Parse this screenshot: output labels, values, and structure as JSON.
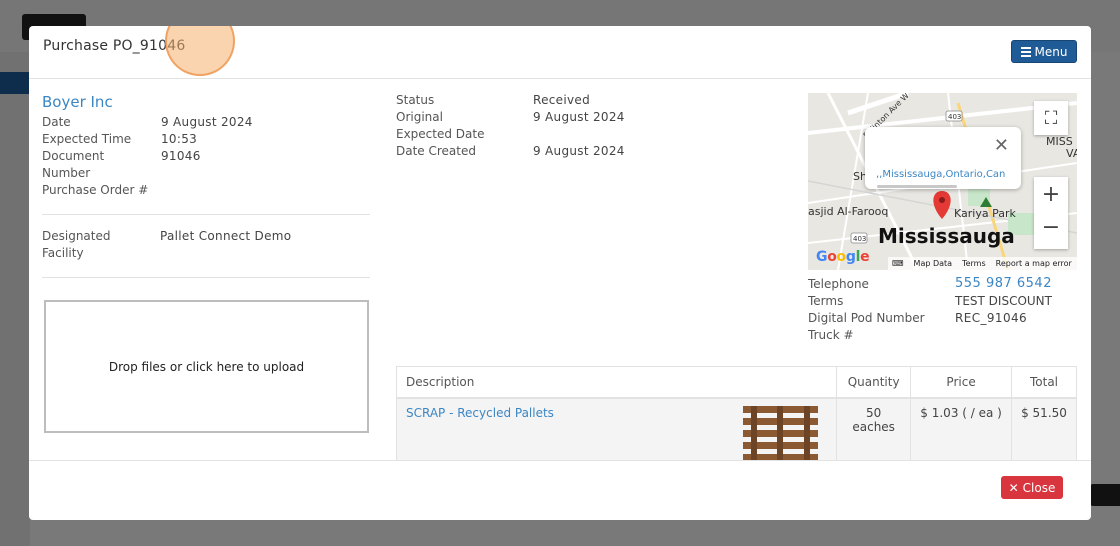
{
  "modal": {
    "title": "Purchase PO_91046",
    "menu_label": "Menu",
    "close_label": "Close"
  },
  "vendor": "Boyer Inc",
  "details_left": [
    {
      "label": "Date",
      "value": "9 August 2024"
    },
    {
      "label": "Expected Time",
      "value": "10:53"
    },
    {
      "label": "Document Number",
      "value": "91046"
    },
    {
      "label": "Purchase Order #",
      "value": ""
    }
  ],
  "facility": {
    "label": "Designated Facility",
    "value": "Pallet Connect Demo"
  },
  "dropzone_text": "Drop files or click here to upload",
  "details_mid": [
    {
      "label": "Status",
      "value": "Received"
    },
    {
      "label": "Original Expected Date",
      "value": "9 August 2024"
    },
    {
      "label": "Date Created",
      "value": "9 August 2024"
    }
  ],
  "map": {
    "popup_link": ",,Mississauga,Ontario,Can",
    "city": "Mississauga",
    "labels": [
      "Kariya Park",
      "asjid Al-Farooq",
      "Sh",
      "MISS",
      "VA",
      "Eglinton Ave W"
    ],
    "road_numbers": [
      "403",
      "403"
    ],
    "google": "Google",
    "footer": [
      "Map Data",
      "Terms",
      "Report a map error"
    ]
  },
  "details_right": [
    {
      "label": "Telephone",
      "value": "555 987 6542"
    },
    {
      "label": "Terms",
      "value": "TEST DISCOUNT"
    },
    {
      "label": "Digital Pod Number",
      "value": "REC_91046"
    },
    {
      "label": "Truck #",
      "value": ""
    }
  ],
  "table": {
    "headers": [
      "Description",
      "Quantity",
      "Price",
      "Total"
    ],
    "rows": [
      {
        "description": "SCRAP - Recycled Pallets",
        "quantity": "50 eaches",
        "price": "$ 1.03 ( / ea )",
        "total": "$ 51.50"
      }
    ]
  },
  "colors": {
    "link": "#3c86c4",
    "menu_button": "#1f5b96",
    "close_button": "#d9353f",
    "map_pin": "#e53935"
  }
}
